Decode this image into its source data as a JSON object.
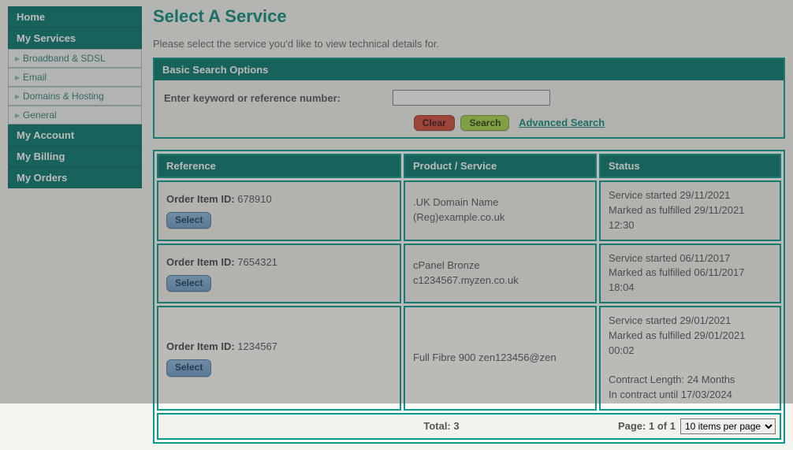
{
  "sidebar": {
    "home": "Home",
    "myServices": "My Services",
    "sub": [
      "Broadband & SDSL",
      "Email",
      "Domains & Hosting",
      "General"
    ],
    "myAccount": "My Account",
    "myBilling": "My Billing",
    "myOrders": "My Orders"
  },
  "page": {
    "title": "Select A Service",
    "intro": "Please select the service you'd like to view technical details for."
  },
  "searchPanel": {
    "header": "Basic Search Options",
    "keywordLabel": "Enter keyword or reference number:",
    "keywordValue": "",
    "clearLabel": "Clear",
    "searchLabel": "Search",
    "advancedLabel": "Advanced Search"
  },
  "table": {
    "headers": {
      "reference": "Reference",
      "product": "Product / Service",
      "status": "Status"
    },
    "orderItemLabel": "Order Item ID:",
    "selectLabel": "Select",
    "rows": [
      {
        "id": "678910",
        "product": ".UK Domain Name (Reg)example.co.uk",
        "status": "Service started 29/11/2021\nMarked as fulfilled 29/11/2021 12:30"
      },
      {
        "id": "7654321",
        "product": "cPanel Bronze c1234567.myzen.co.uk",
        "status": "Service started 06/11/2017\nMarked as fulfilled 06/11/2017 18:04"
      },
      {
        "id": "1234567",
        "product": "Full Fibre 900 zen123456@zen",
        "status": "Service started 29/01/2021\nMarked as fulfilled 29/01/2021 00:02\n\nContract Length: 24 Months\nIn contract until 17/03/2024"
      }
    ],
    "footer": {
      "totalLabel": "Total:",
      "totalValue": "3",
      "pageLabel": "Page:",
      "pageCurrent": "1",
      "pageOf": "of",
      "pageTotal": "1",
      "perPageSelected": "10 items per page",
      "perPageOptions": [
        "10 items per page"
      ]
    }
  }
}
